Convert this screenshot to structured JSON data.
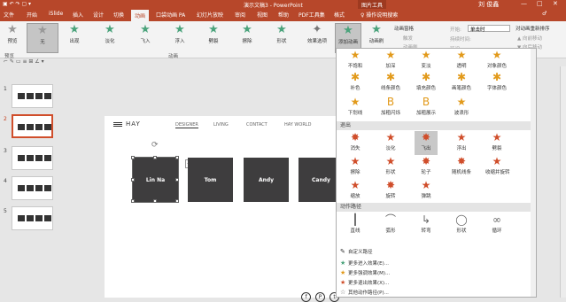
{
  "titlebar": {
    "doc_title": "演示文稿3 - PowerPoint",
    "tool_context": "图片工具",
    "user": "刘 俊鑫",
    "min": "—",
    "max": "□",
    "close": "✕",
    "qat": "▣ ↶ ↷ ▢ ▾"
  },
  "tabs": [
    "文件",
    "开始",
    "iSlide",
    "插入",
    "设计",
    "切换",
    "动画",
    "口袋动画 PA",
    "幻灯片放映",
    "审阅",
    "视图",
    "帮助",
    "PDF工具集",
    "格式"
  ],
  "active_tab": "动画",
  "tellme": "♀ 操作说明搜索",
  "share": "♂",
  "ribbon": {
    "preview": {
      "icon": "★",
      "label": "预览"
    },
    "group_preview": "预览",
    "group_animation": "动画",
    "animations": [
      {
        "label": "无",
        "icon": "★"
      },
      {
        "label": "出现",
        "icon": "★"
      },
      {
        "label": "淡化",
        "icon": "★"
      },
      {
        "label": "飞入",
        "icon": "★"
      },
      {
        "label": "浮入",
        "icon": "★"
      },
      {
        "label": "劈裂",
        "icon": "★"
      },
      {
        "label": "擦除",
        "icon": "★"
      },
      {
        "label": "形状",
        "icon": "★"
      }
    ],
    "effect_options": "效果选项",
    "add_animation": "添加动画",
    "animation_brush": "动画刷",
    "animation_pane": "动画窗格",
    "trigger": "触发",
    "animation_painter": "动画刷",
    "start_label": "开始:",
    "start_value": "单击时",
    "duration_label": "持续时间:",
    "delay_label": "延迟:",
    "reorder": "对动画重新排序",
    "move_earlier": "▲ 向前移动",
    "move_later": "▼ 向后移动"
  },
  "status_toolbar": "⌐ ✎ ▭ ≡ ⊞ ∠ ▾",
  "thumbnails": [
    {
      "num": "1"
    },
    {
      "num": "2"
    },
    {
      "num": "3"
    },
    {
      "num": "4"
    },
    {
      "num": "5"
    }
  ],
  "slide": {
    "brand": "HAY",
    "nav": [
      "DESIGNER",
      "LIVING",
      "CONTACT",
      "HAY WORLD"
    ],
    "people": [
      "Lin Na",
      "Tom",
      "Andy",
      "Candy"
    ],
    "social": [
      "f",
      "P",
      "t"
    ]
  },
  "dropdown": {
    "row0": [
      {
        "label": "不饱和",
        "icon": "★",
        "c": "#e29a1b"
      },
      {
        "label": "加深",
        "icon": "★",
        "c": "#e29a1b"
      },
      {
        "label": "变淡",
        "icon": "★",
        "c": "#e29a1b"
      },
      {
        "label": "透明",
        "icon": "★",
        "c": "#e29a1b"
      },
      {
        "label": "对象颜色",
        "icon": "★",
        "c": "#e29a1b"
      }
    ],
    "row1": [
      {
        "label": "补色",
        "icon": "✱",
        "c": "#e29a1b"
      },
      {
        "label": "线条颜色",
        "icon": "✱",
        "c": "#e29a1b"
      },
      {
        "label": "填充颜色",
        "icon": "✱",
        "c": "#e29a1b"
      },
      {
        "label": "画笔颜色",
        "icon": "✱",
        "c": "#e29a1b"
      },
      {
        "label": "字体颜色",
        "icon": "✱",
        "c": "#e29a1b"
      }
    ],
    "row2": [
      {
        "label": "下划线",
        "icon": "★",
        "c": "#e29a1b"
      },
      {
        "label": "加粗闪烁",
        "icon": "B",
        "c": "#e29a1b"
      },
      {
        "label": "加粗展示",
        "icon": "B",
        "c": "#e29a1b"
      },
      {
        "label": "波浪形",
        "icon": "★",
        "c": "#e29a1b"
      }
    ],
    "section_exit": "退出",
    "exit_row0": [
      {
        "label": "消失",
        "icon": "✸",
        "c": "#d04e2b"
      },
      {
        "label": "淡化",
        "icon": "★",
        "c": "#d04e2b"
      },
      {
        "label": "飞出",
        "icon": "✸",
        "c": "#d04e2b"
      },
      {
        "label": "浮出",
        "icon": "★",
        "c": "#d04e2b"
      },
      {
        "label": "劈裂",
        "icon": "★",
        "c": "#d04e2b"
      }
    ],
    "exit_row1": [
      {
        "label": "擦除",
        "icon": "★",
        "c": "#d04e2b"
      },
      {
        "label": "形状",
        "icon": "★",
        "c": "#d04e2b"
      },
      {
        "label": "轮子",
        "icon": "✸",
        "c": "#d04e2b"
      },
      {
        "label": "随机线条",
        "icon": "✸",
        "c": "#d04e2b"
      },
      {
        "label": "收缩并旋转",
        "icon": "★",
        "c": "#d04e2b"
      }
    ],
    "exit_row2": [
      {
        "label": "缩放",
        "icon": "★",
        "c": "#d04e2b"
      },
      {
        "label": "旋转",
        "icon": "✸",
        "c": "#d04e2b"
      },
      {
        "label": "弹跳",
        "icon": "★",
        "c": "#d04e2b"
      }
    ],
    "section_path": "动作路径",
    "path_row": [
      {
        "label": "直线",
        "icon": "┃",
        "c": "#666"
      },
      {
        "label": "弧形",
        "icon": "⌒",
        "c": "#666"
      },
      {
        "label": "转弯",
        "icon": "↳",
        "c": "#666"
      },
      {
        "label": "形状",
        "icon": "◯",
        "c": "#666"
      },
      {
        "label": "循环",
        "icon": "∞",
        "c": "#666"
      }
    ],
    "custom_path": "自定义路径",
    "more": [
      {
        "icon": "★",
        "c": "#4aa37b",
        "label": "更多进入效果(E)..."
      },
      {
        "icon": "★",
        "c": "#e29a1b",
        "label": "更多强调效果(M)..."
      },
      {
        "icon": "★",
        "c": "#d04e2b",
        "label": "更多退出效果(X)..."
      },
      {
        "icon": "☆",
        "c": "#666",
        "label": "其他动作路径(P)..."
      }
    ]
  }
}
